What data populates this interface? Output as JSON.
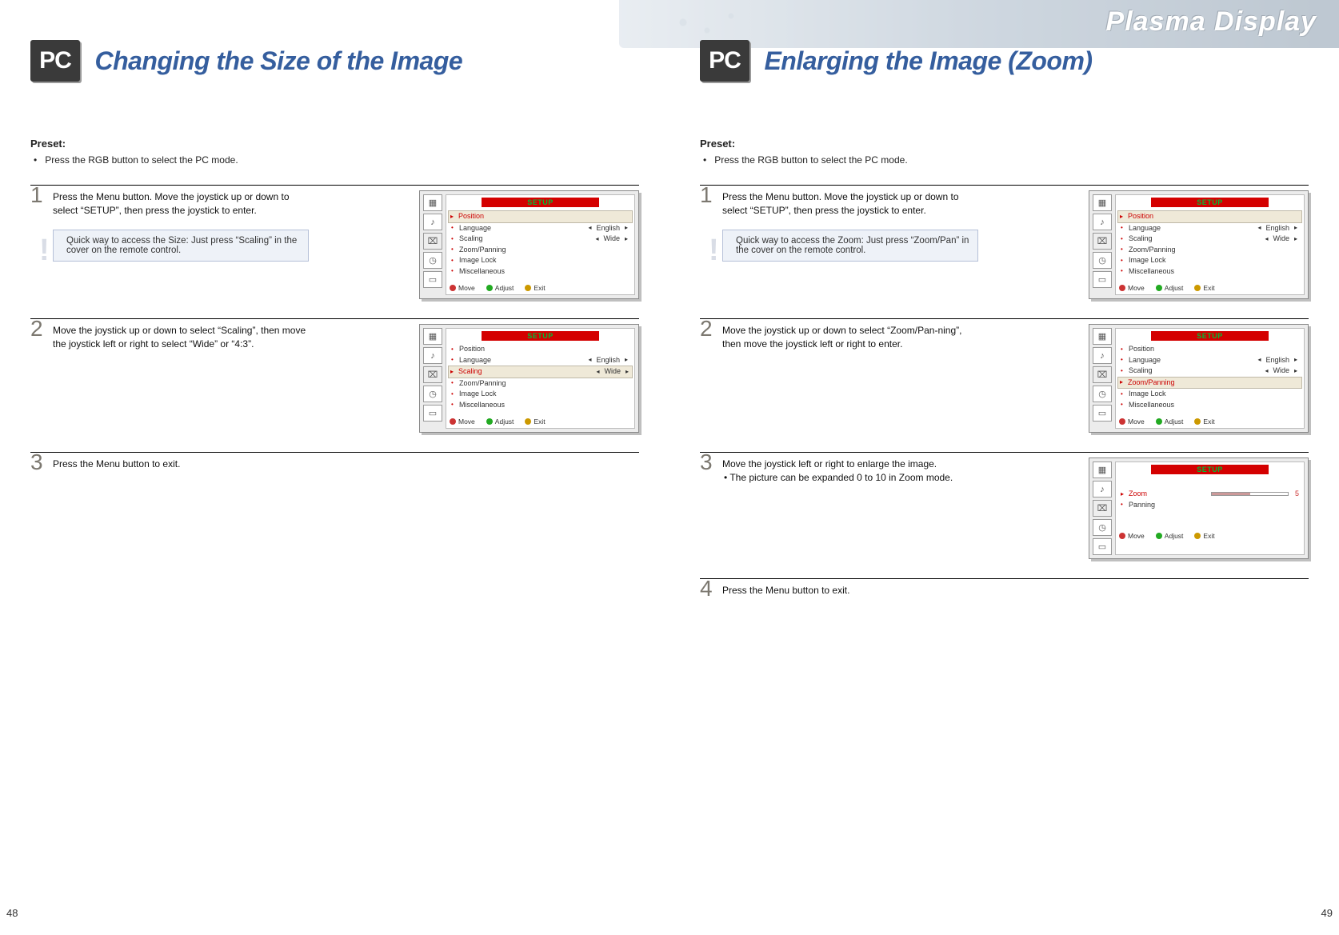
{
  "brand": "Plasma Display",
  "pc_badge": "PC",
  "osd_title": "SETUP",
  "osd_footer": {
    "move": "Move",
    "adjust": "Adjust",
    "exit": "Exit"
  },
  "menu_items": {
    "position": "Position",
    "language": "Language",
    "scaling": "Scaling",
    "zoom_panning": "Zoom/Panning",
    "image_lock": "Image Lock",
    "misc": "Miscellaneous",
    "zoom": "Zoom",
    "panning": "Panning"
  },
  "values": {
    "english": "English",
    "wide": "Wide",
    "zoom_level": "5"
  },
  "left": {
    "title": "Changing the Size of the Image",
    "preset_label": "Preset:",
    "preset_text": "Press the RGB button to select the PC mode.",
    "steps": [
      {
        "num": "1",
        "text": "Press the Menu button. Move the joystick up or down to select “SETUP”, then press the joystick to enter.",
        "tip": "Quick way to access the Size: Just press “Scaling” in the cover on the remote control."
      },
      {
        "num": "2",
        "text": "Move the joystick up or down to select “Scaling”, then move the joystick left or right to select  “Wide” or “4:3”."
      },
      {
        "num": "3",
        "text": "Press the Menu button to exit."
      }
    ],
    "page_num": "48"
  },
  "right": {
    "title": "Enlarging the Image (Zoom)",
    "preset_label": "Preset:",
    "preset_text": "Press the RGB button to select the PC mode.",
    "steps": [
      {
        "num": "1",
        "text": "Press the Menu button. Move the joystick up or down to select  “SETUP”, then press the joystick to enter.",
        "tip": "Quick way to access the Zoom: Just press “Zoom/Pan” in the cover on the remote control."
      },
      {
        "num": "2",
        "text": "Move the joystick up or down to select “Zoom/Pan-ning”, then move the joystick left or right  to enter."
      },
      {
        "num": "3",
        "text": "Move the joystick left or right to enlarge the image.",
        "bullet": "The picture can be expanded 0 to 10 in Zoom mode."
      },
      {
        "num": "4",
        "text": "Press the Menu button to exit."
      }
    ],
    "page_num": "49"
  }
}
